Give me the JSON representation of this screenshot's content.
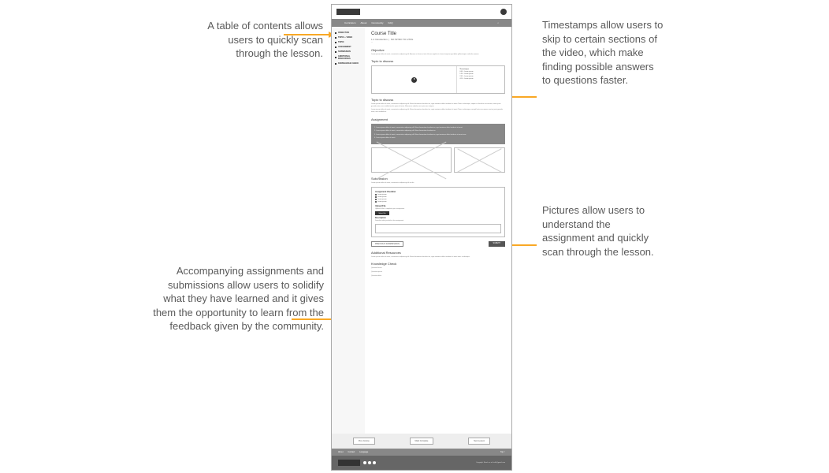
{
  "annotations": {
    "toc": "A table of contents allows users to quickly scan through the lesson.",
    "timestamps": "Timestamps allow users to skip to certain sections of the video, which make finding possible answers to questions faster.",
    "pictures": "Pictures allow users to understand the assignment and quickly scan through the lesson.",
    "assignments": "Accompanying assignments and submissions allow users to solidify what they have learned and it gives them the opportunity to learn from the feedback given by the community."
  },
  "wireframe": {
    "nav": {
      "items": [
        "Curriculum",
        "About",
        "Community",
        "FAQ"
      ]
    },
    "sidebar": {
      "items": [
        "OBJECTIVE",
        "TOPIC + VIDEO",
        "TOPIC",
        "ASSIGNMENT",
        "SUBMISSION",
        "ADDITIONAL RESOURCES",
        "KNOWLEDGE CHECK"
      ]
    },
    "main": {
      "course_title": "Course Title",
      "lesson_subtitle": "1.4 Introduction",
      "lesson_meta": "NO INTRO TO HTML",
      "objective": {
        "title": "Objective",
        "text": "Lorem ipsum dolor sit amet, consectetur adipiscing elit. Aenean ac lorem at nisi ultrices sagittis et sit amet sapien eget dolor pellentesque vehicula aenean."
      },
      "topic_video": {
        "title": "Topic to discuss",
        "timestamps_header": "Timestamps",
        "timestamps": [
          "0:00 - Lorem ipsum",
          "1:30 - Lorem ipsum",
          "2:45 - Lorem ipsum",
          "4:10 - Lorem ipsum"
        ]
      },
      "topic_text": {
        "title": "Topic to discuss",
        "para1": "Lorem ipsum dolor sit amet, consectetur adipiscing elit. Etiam fermentum tincidunt ex, eget maximus dolor tincidunt sit amet. Nunc scelerisque, sapien ac faucibus accumsan, metus justo gravida enim, non vestibulum dui quam id tortor. Maecenas sodales orci quis nunc tempor.",
        "para2": "Lorem ipsum dolor sit amet, consectetur adipiscing elit. Etiam fermentum tincidunt ex, eget maximus dolor tincidunt sit amet. Nunc scelerisque suscipit luctus accumsan, metus justo gravida enim, non vestibulum."
      },
      "assignment": {
        "title": "Assignment",
        "line1": "1. Lorem ipsum dolor sit amet, consectetur adipiscing elit. Etiam fermentum tincidunt ex, eget maximus dolor tincidunt sit amet.",
        "line2": "2. Lorem ipsum dolor sit amet, consectetur adipiscing elit. Etiam fermentum tincidunt ex.",
        "line3": "3. Lorem ipsum dolor sit amet, consectetur adipiscing elit. Etiam fermentum tincidunt ex, eget maximus dolor tincidunt sit amet nunc.",
        "line4": "4. Lorem ipsum dolor sit amet."
      },
      "submission": {
        "title": "Submission",
        "intro": "Lorem ipsum dolor sit amet, consectetur adipiscing elit iaculis.",
        "checklist_title": "Assignment Checklist",
        "checklist": [
          "Lorem ipsum",
          "Lorem ipsum",
          "Lorem ipsum",
          "Lorem ipsum"
        ],
        "upload_title": "Upload File",
        "upload_hint": "Upload a file to complete your assignment",
        "upload_btn": "Select File",
        "description_title": "Description",
        "description_hint": "Describe what you did in this assignment",
        "previous_btn": "PREVIOUS SUBMISSIONS",
        "submit_btn": "SUBMIT"
      },
      "additional": {
        "title": "Additional Resources",
        "text": "Lorem ipsum dolor sit amet, consectetur adipiscing elit. Etiam fermentum tincidunt ex, eget maximus dolor tincidunt sit amet nunc scelerisque."
      },
      "knowledge": {
        "title": "Knowledge Check",
        "q1": "Question lorem",
        "q2": "Question ipsum",
        "q3": "Question dolor"
      },
      "bottom_nav": {
        "prev": "Prev Course",
        "complete": "Mark Complete",
        "next": "Next Lesson"
      }
    },
    "footer": {
      "links": [
        "About",
        "Contact",
        "Language"
      ],
      "top": "Top ↑",
      "copyright": "Copyright. Reach us at: hello@gmail.com"
    }
  }
}
